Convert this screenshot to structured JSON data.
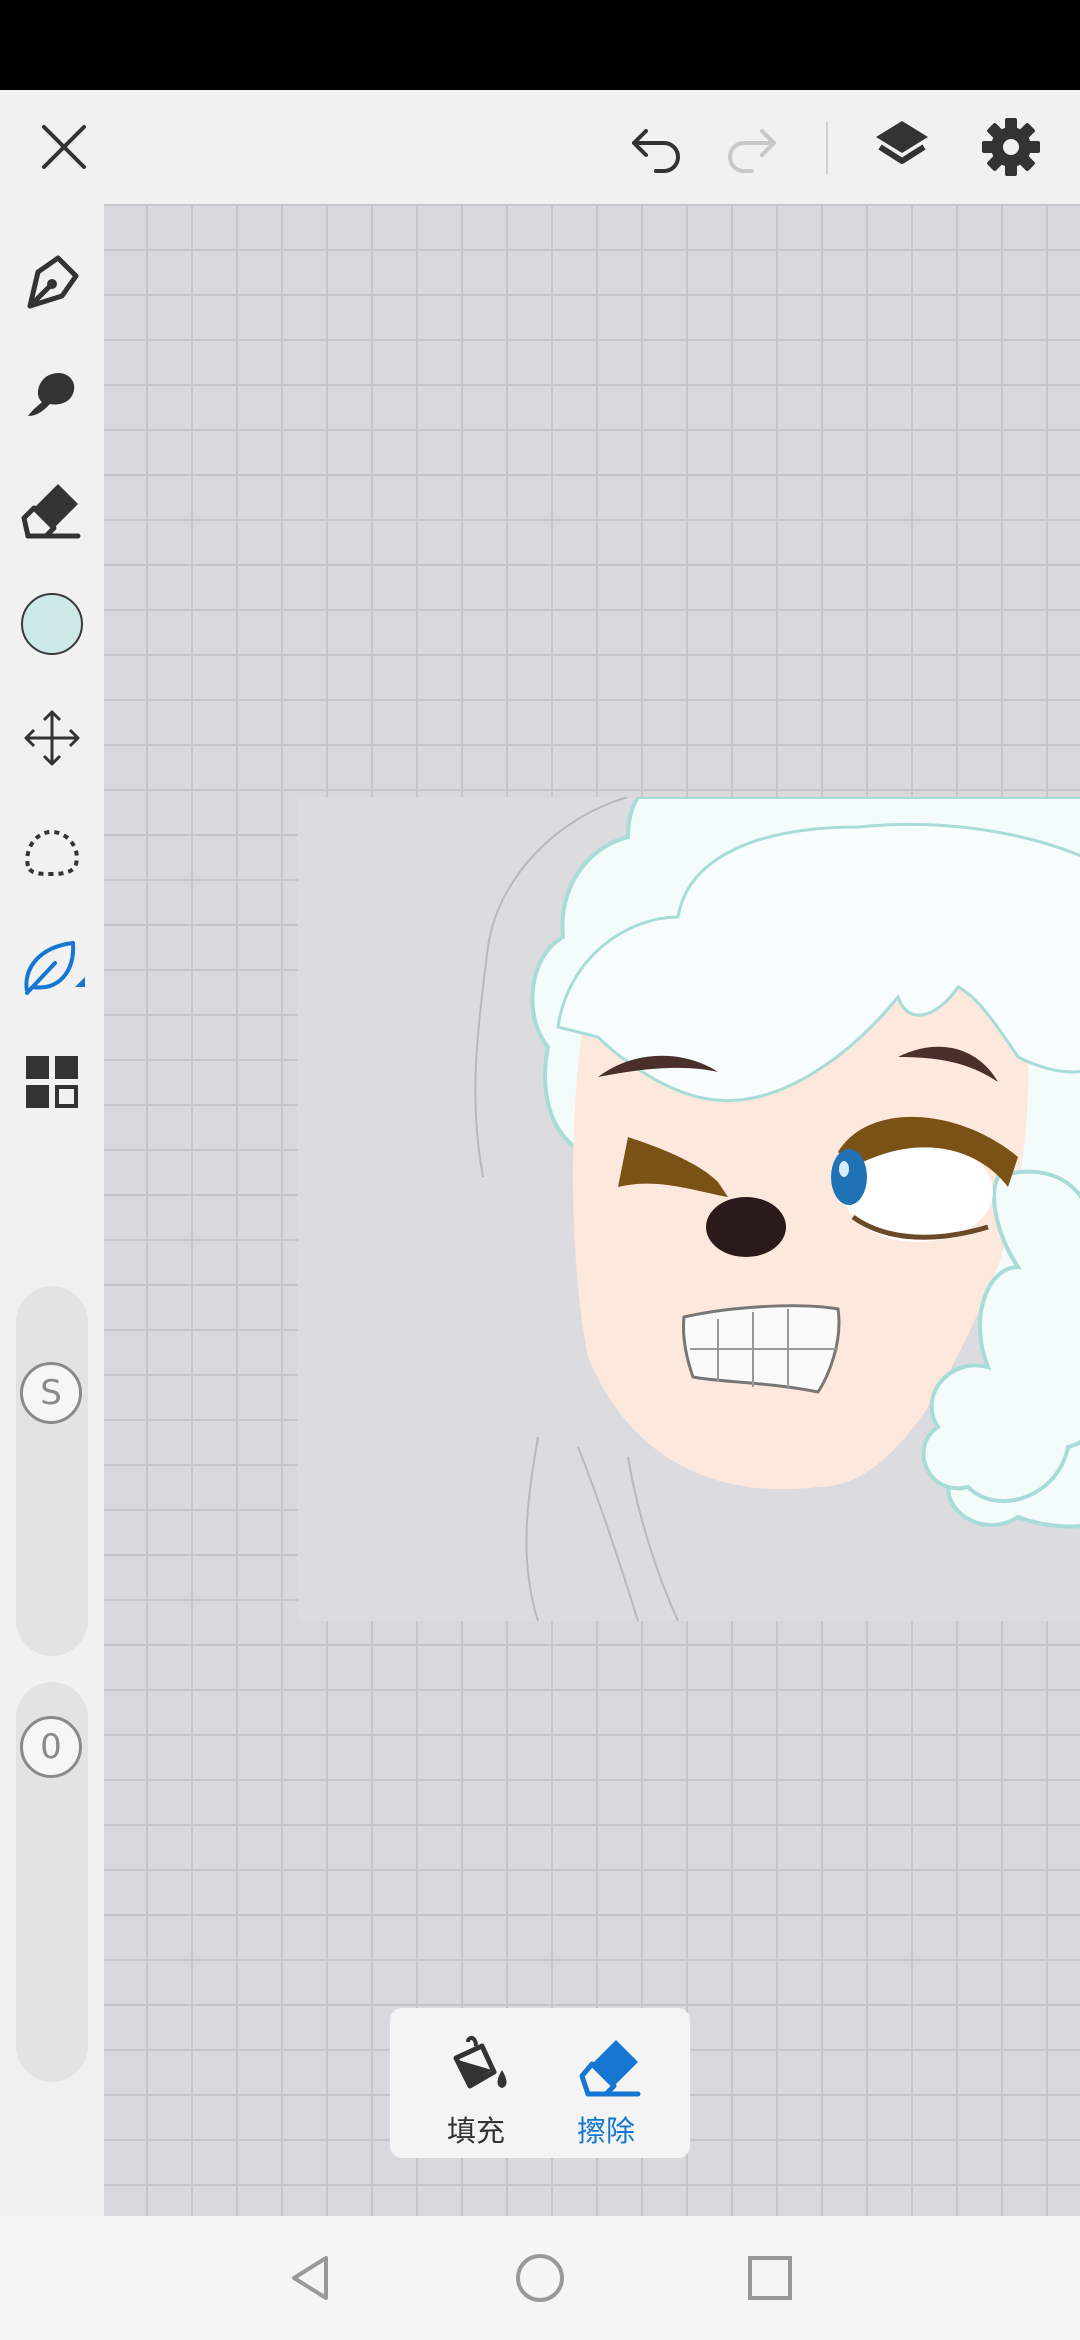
{
  "top_bar": {
    "close_icon": "close-icon",
    "undo_icon": "undo-icon",
    "redo_icon": "redo-icon",
    "layers_icon": "layers-icon",
    "settings_icon": "gear-icon"
  },
  "sidebar": {
    "tools": [
      {
        "name": "pen-tool",
        "icon": "pen-nib-icon"
      },
      {
        "name": "smudge-tool",
        "icon": "smudge-icon"
      },
      {
        "name": "eraser-tool",
        "icon": "eraser-icon"
      },
      {
        "name": "color-picker",
        "icon": "color-swatch",
        "color": "#cce9e7"
      },
      {
        "name": "move-tool",
        "icon": "move-arrows-icon"
      },
      {
        "name": "lasso-tool",
        "icon": "lasso-icon"
      },
      {
        "name": "fill-tool",
        "icon": "leaf-icon",
        "active": true,
        "accent": "#1677d2"
      },
      {
        "name": "more-tools",
        "icon": "grid-icon"
      }
    ],
    "size_slider": {
      "label": "S"
    },
    "opacity_slider": {
      "label": "0"
    }
  },
  "popup": {
    "fill_label": "填充",
    "erase_label": "擦除",
    "active": "erase"
  },
  "nav_bar": {
    "back_icon": "back-triangle-icon",
    "home_icon": "home-circle-icon",
    "recents_icon": "recents-square-icon"
  },
  "colors": {
    "accent": "#1677d2",
    "icon": "#333333",
    "disabled": "#c8c8c8",
    "swatch": "#cce9e7"
  }
}
